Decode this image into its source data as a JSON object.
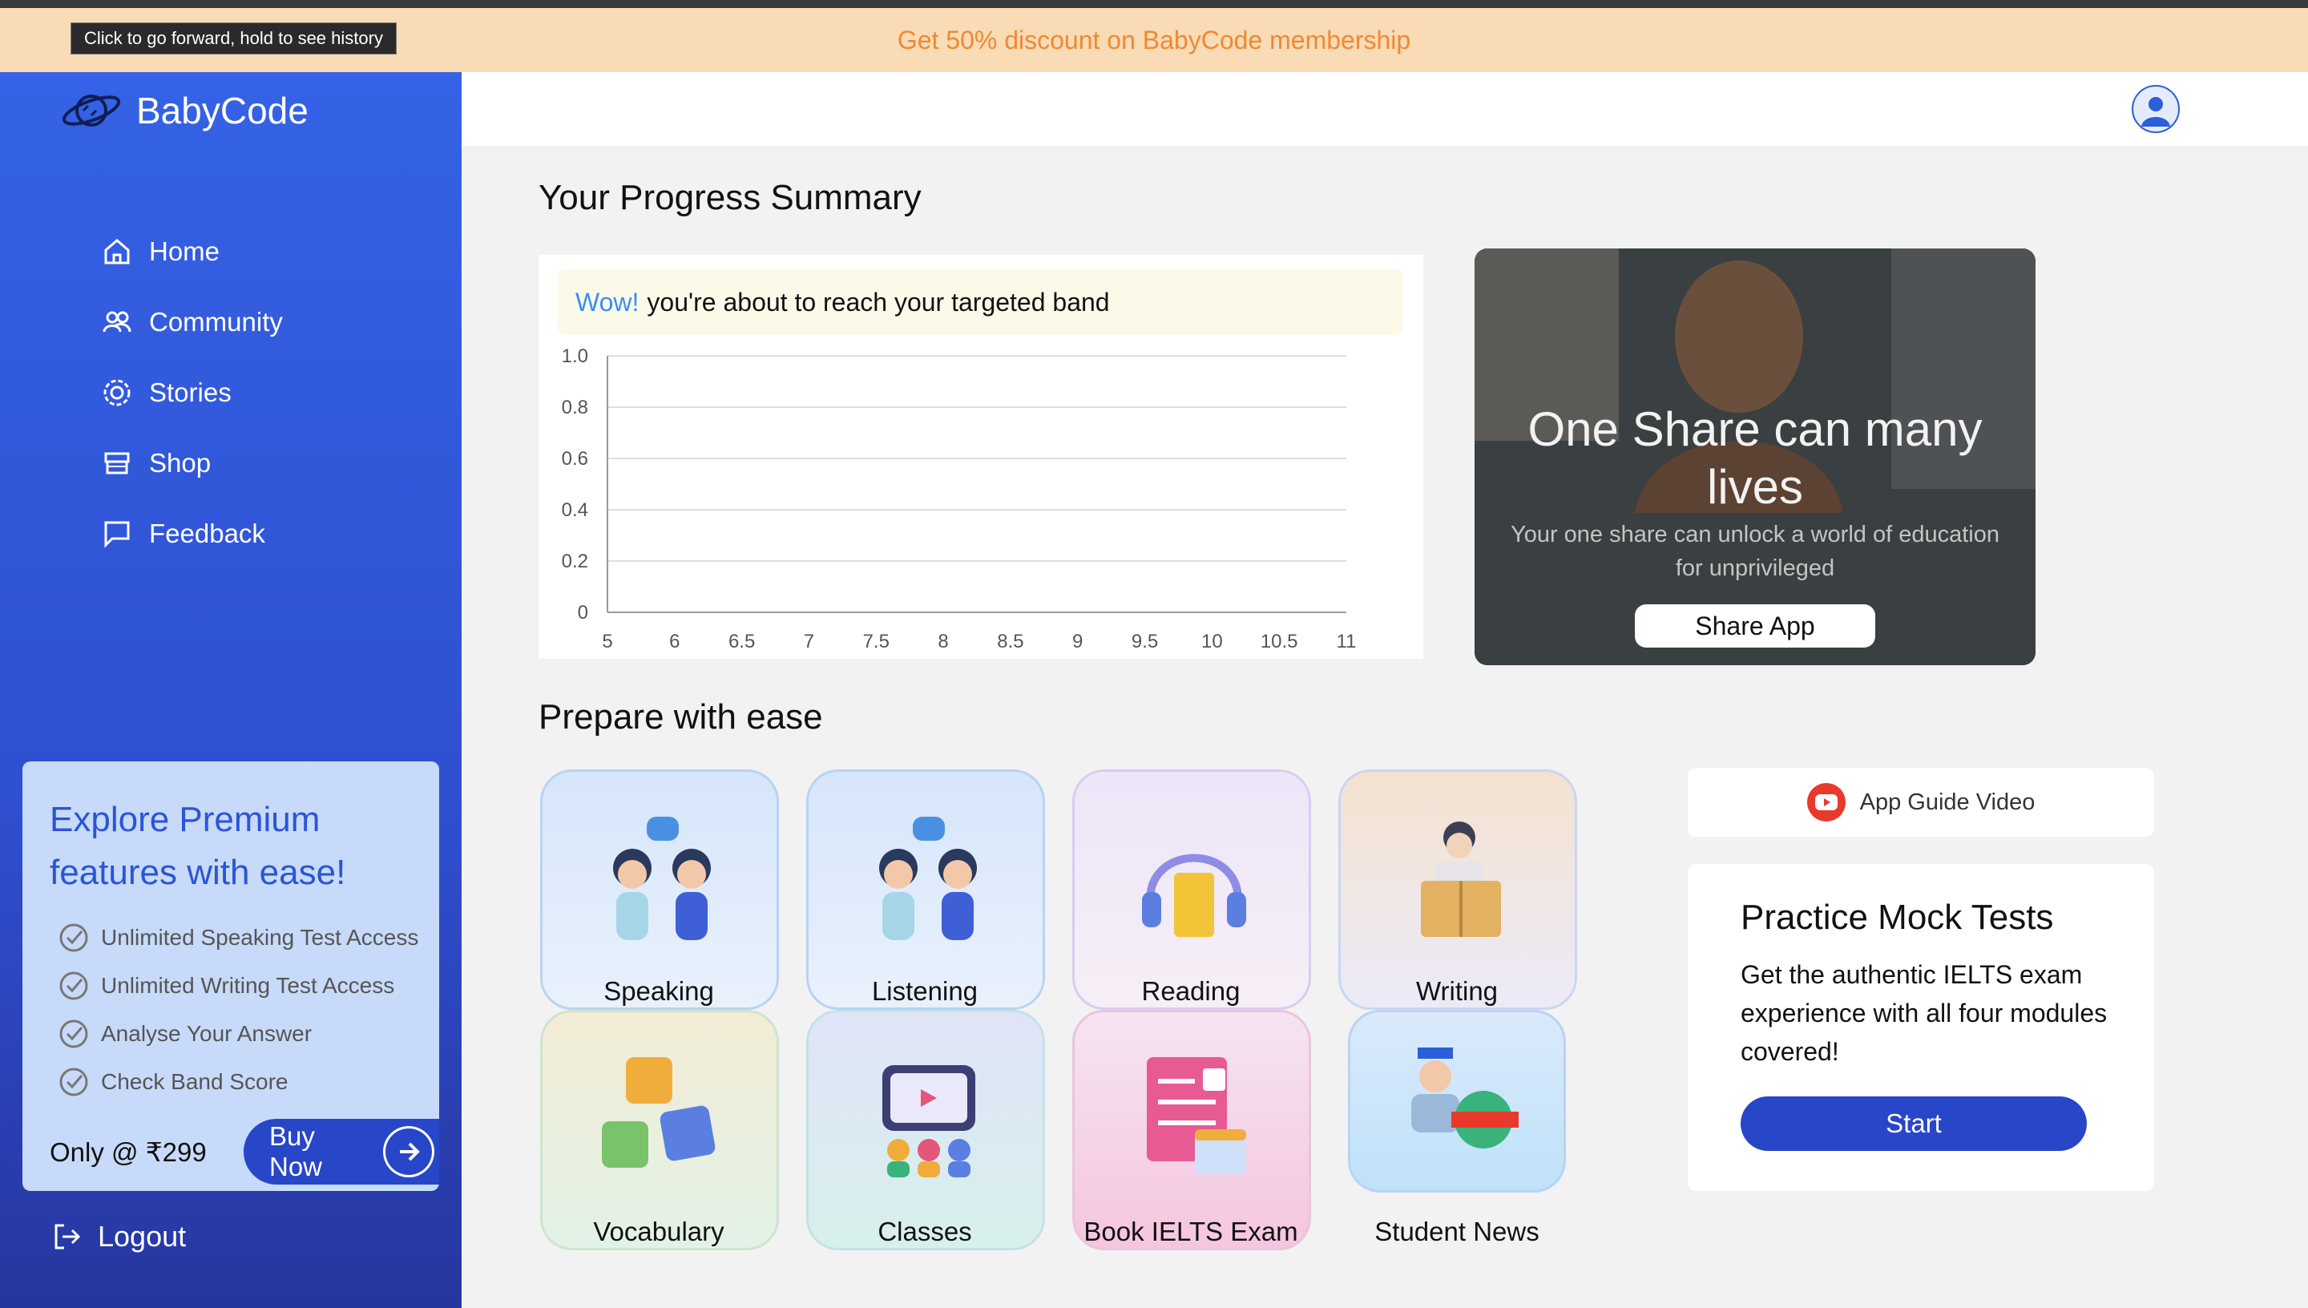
{
  "browser": {
    "tooltip": "Click to go forward, hold to see history"
  },
  "promo": {
    "text": "Get 50% discount on BabyCode membership"
  },
  "brand": {
    "name": "BabyCode"
  },
  "sidebar": {
    "items": [
      {
        "label": "Home",
        "icon": "home-icon"
      },
      {
        "label": "Community",
        "icon": "community-icon"
      },
      {
        "label": "Stories",
        "icon": "stories-icon"
      },
      {
        "label": "Shop",
        "icon": "shop-icon"
      },
      {
        "label": "Feedback",
        "icon": "feedback-icon"
      }
    ],
    "logout": "Logout"
  },
  "premium": {
    "title": "Explore Premium features with ease!",
    "features": [
      "Unlimited Speaking Test Access",
      "Unlimited Writing Test Access",
      "Analyse Your Answer",
      "Check Band Score"
    ],
    "price": "Only @ ₹299",
    "buy_label": "Buy Now"
  },
  "progress": {
    "heading": "Your Progress Summary",
    "banner_wow": "Wow!",
    "banner_text": "you're about to reach your targeted band"
  },
  "chart_data": {
    "type": "line",
    "x_ticks": [
      "5",
      "6",
      "6.5",
      "7",
      "7.5",
      "8",
      "8.5",
      "9",
      "9.5",
      "10",
      "10.5",
      "11"
    ],
    "y_ticks": [
      "0",
      "0.2",
      "0.4",
      "0.6",
      "0.8",
      "1.0"
    ],
    "ylim": [
      0,
      1
    ],
    "series": [],
    "grid": true
  },
  "share": {
    "title": "One Share can many lives",
    "subtitle": "Your one share can unlock a world of education for unprivileged",
    "button": "Share App"
  },
  "prepare": {
    "heading": "Prepare with ease",
    "tiles": [
      {
        "label": "Speaking",
        "icon": "speaking-icon"
      },
      {
        "label": "Listening",
        "icon": "listening-icon"
      },
      {
        "label": "Reading",
        "icon": "reading-icon"
      },
      {
        "label": "Writing",
        "icon": "writing-icon"
      },
      {
        "label": "Vocabulary",
        "icon": "vocabulary-icon"
      },
      {
        "label": "Classes",
        "icon": "classes-icon"
      },
      {
        "label": "Book IELTS Exam",
        "icon": "book-exam-icon"
      },
      {
        "label": "Student News",
        "icon": "student-news-icon"
      }
    ]
  },
  "guide": {
    "label": "App Guide Video"
  },
  "mock": {
    "title": "Practice Mock Tests",
    "description": "Get the authentic IELTS exam experience with all four modules covered!",
    "start": "Start"
  },
  "colors": {
    "primary": "#2746c8",
    "sidebar": "#3562e6",
    "promo_bg": "#f9dbb5",
    "promo_text": "#ee8a33",
    "accent": "#3b8ef5"
  }
}
